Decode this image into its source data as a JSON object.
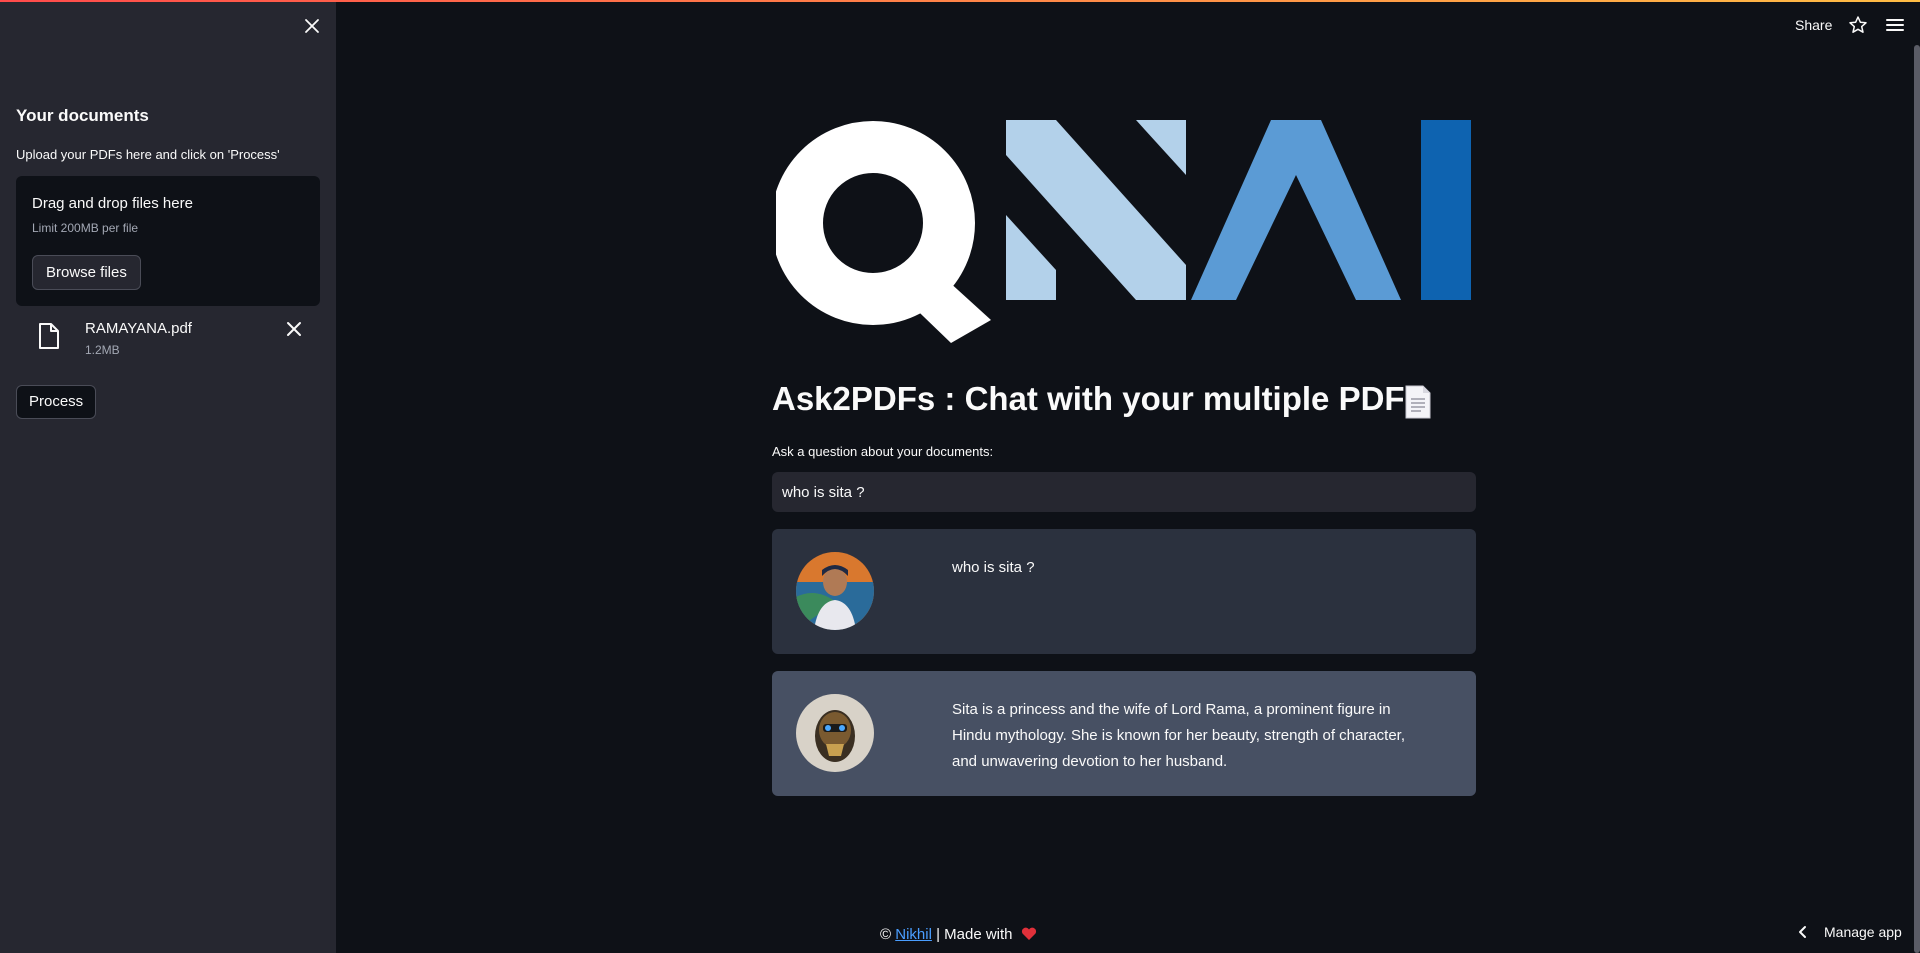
{
  "sidebar": {
    "title": "Your documents",
    "caption": "Upload your PDFs here and click on 'Process'",
    "dropzone": {
      "title": "Drag and drop files here",
      "limit": "Limit 200MB per file",
      "browse_label": "Browse files"
    },
    "file": {
      "name": "RAMAYANA.pdf",
      "size": "1.2MB"
    },
    "process_label": "Process"
  },
  "header": {
    "share_label": "Share"
  },
  "logo": {
    "text": "QNAI",
    "colors": [
      "#ffffff",
      "#b3d1ea",
      "#5b9bd5",
      "#0e63b0"
    ]
  },
  "main": {
    "title": "Ask2PDFs : Chat with your multiple PDFs",
    "question_label": "Ask a question about your documents:",
    "question_value": "who is sita ?",
    "messages": [
      {
        "role": "user",
        "text": "who is sita ?"
      },
      {
        "role": "bot",
        "text": "Sita is a princess and the wife of Lord Rama, a prominent figure in Hindu mythology. She is known for her beauty, strength of character, and unwavering devotion to her husband."
      }
    ]
  },
  "footer": {
    "copyright": "©",
    "author": "Nikhil",
    "made_with": "| Made with"
  },
  "manage_app_label": "Manage app",
  "colors": {
    "background": "#0e1117",
    "sidebar": "#262730",
    "user_msg": "#2b313e",
    "bot_msg": "#475063",
    "accent": "#ff4b4b"
  }
}
